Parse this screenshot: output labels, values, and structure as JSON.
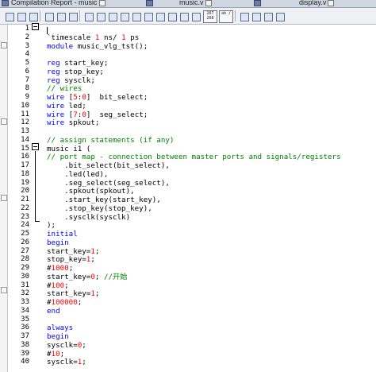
{
  "tabs": [
    {
      "label": "Compilation Report - music"
    },
    {
      "label": "music.v"
    },
    {
      "label": "display.v"
    }
  ],
  "toolbar": {
    "tag_labels": [
      "267 268",
      "ab /"
    ]
  },
  "editor": {
    "lines": [
      {
        "n": "1",
        "t": [],
        "fold": "",
        "indent": 0
      },
      {
        "n": "2",
        "t": [
          [
            "`timescale ",
            ""
          ],
          [
            "1",
            "num"
          ],
          [
            " ns/ ",
            ""
          ],
          [
            "1",
            "num"
          ],
          [
            " ps",
            ""
          ]
        ]
      },
      {
        "n": "3",
        "t": [
          [
            "module",
            "kw"
          ],
          [
            " music_vlg_tst();",
            ""
          ]
        ]
      },
      {
        "n": "4",
        "t": []
      },
      {
        "n": "5",
        "t": [
          [
            "reg",
            "kw"
          ],
          [
            " start_key;",
            ""
          ]
        ]
      },
      {
        "n": "6",
        "t": [
          [
            "reg",
            "kw"
          ],
          [
            " stop_key;",
            ""
          ]
        ]
      },
      {
        "n": "7",
        "t": [
          [
            "reg",
            "kw"
          ],
          [
            " sysclk;",
            ""
          ]
        ]
      },
      {
        "n": "8",
        "t": [
          [
            "// wires",
            "com"
          ]
        ]
      },
      {
        "n": "9",
        "t": [
          [
            "wire",
            "kw"
          ],
          [
            " [",
            ""
          ],
          [
            "5",
            "num"
          ],
          [
            ":",
            ""
          ],
          [
            "0",
            "num"
          ],
          [
            "]  bit_select;",
            ""
          ]
        ]
      },
      {
        "n": "10",
        "t": [
          [
            "wire",
            "kw"
          ],
          [
            " led;",
            ""
          ]
        ]
      },
      {
        "n": "11",
        "t": [
          [
            "wire",
            "kw"
          ],
          [
            " [",
            ""
          ],
          [
            "7",
            "num"
          ],
          [
            ":",
            ""
          ],
          [
            "0",
            "num"
          ],
          [
            "]  seg_select;",
            ""
          ]
        ]
      },
      {
        "n": "12",
        "t": [
          [
            "wire",
            "kw"
          ],
          [
            " spkout;",
            ""
          ]
        ]
      },
      {
        "n": "13",
        "t": []
      },
      {
        "n": "14",
        "t": [
          [
            "// assign statements (if any)",
            "com"
          ]
        ]
      },
      {
        "n": "15",
        "t": [
          [
            "music i1 (",
            ""
          ]
        ]
      },
      {
        "n": "16",
        "t": [
          [
            "// port map - connection between master ports and signals/registers",
            "com"
          ]
        ]
      },
      {
        "n": "17",
        "t": [
          [
            "    .bit_select(bit_select),",
            ""
          ]
        ]
      },
      {
        "n": "18",
        "t": [
          [
            "    .led(led),",
            ""
          ]
        ]
      },
      {
        "n": "19",
        "t": [
          [
            "    .seg_select(seg_select),",
            ""
          ]
        ]
      },
      {
        "n": "20",
        "t": [
          [
            "    .spkout(spkout),",
            ""
          ]
        ]
      },
      {
        "n": "21",
        "t": [
          [
            "    .start_key(start_key),",
            ""
          ]
        ]
      },
      {
        "n": "22",
        "t": [
          [
            "    .stop_key(stop_key),",
            ""
          ]
        ]
      },
      {
        "n": "23",
        "t": [
          [
            "    .sysclk(sysclk)",
            ""
          ]
        ]
      },
      {
        "n": "24",
        "t": [
          [
            ");",
            ""
          ]
        ]
      },
      {
        "n": "25",
        "t": [
          [
            "initial",
            "kw"
          ]
        ]
      },
      {
        "n": "26",
        "t": [
          [
            "begin",
            "kw"
          ]
        ]
      },
      {
        "n": "27",
        "t": [
          [
            "start_key=",
            ""
          ],
          [
            "1",
            "num"
          ],
          [
            ";",
            ""
          ]
        ]
      },
      {
        "n": "28",
        "t": [
          [
            "stop_key=",
            ""
          ],
          [
            "1",
            "num"
          ],
          [
            ";",
            ""
          ]
        ]
      },
      {
        "n": "29",
        "t": [
          [
            "#",
            ""
          ],
          [
            "1000",
            "num"
          ],
          [
            ";",
            ""
          ]
        ]
      },
      {
        "n": "30",
        "t": [
          [
            "start_key=",
            ""
          ],
          [
            "0",
            "num"
          ],
          [
            "; ",
            ""
          ],
          [
            "//开始",
            "com"
          ]
        ]
      },
      {
        "n": "31",
        "t": [
          [
            "#",
            ""
          ],
          [
            "100",
            "num"
          ],
          [
            ";",
            ""
          ]
        ]
      },
      {
        "n": "32",
        "t": [
          [
            "start_key=",
            ""
          ],
          [
            "1",
            "num"
          ],
          [
            ";",
            ""
          ]
        ]
      },
      {
        "n": "33",
        "t": [
          [
            "#",
            ""
          ],
          [
            "100000",
            "num"
          ],
          [
            ";",
            ""
          ]
        ]
      },
      {
        "n": "34",
        "t": [
          [
            "end",
            "kw"
          ]
        ]
      },
      {
        "n": "35",
        "t": []
      },
      {
        "n": "36",
        "t": [
          [
            "always",
            "kw"
          ]
        ]
      },
      {
        "n": "37",
        "t": [
          [
            "begin",
            "kw"
          ]
        ]
      },
      {
        "n": "38",
        "t": [
          [
            "sysclk=",
            ""
          ],
          [
            "0",
            "num"
          ],
          [
            ";",
            ""
          ]
        ]
      },
      {
        "n": "39",
        "t": [
          [
            "#",
            ""
          ],
          [
            "10",
            "num"
          ],
          [
            ";",
            ""
          ]
        ]
      },
      {
        "n": "40",
        "t": [
          [
            "sysclk=",
            ""
          ],
          [
            "1",
            "num"
          ],
          [
            ";",
            ""
          ]
        ]
      }
    ]
  },
  "colors": {
    "keyword": "#0000ff",
    "number": "#ff0000",
    "comment": "#008000"
  }
}
